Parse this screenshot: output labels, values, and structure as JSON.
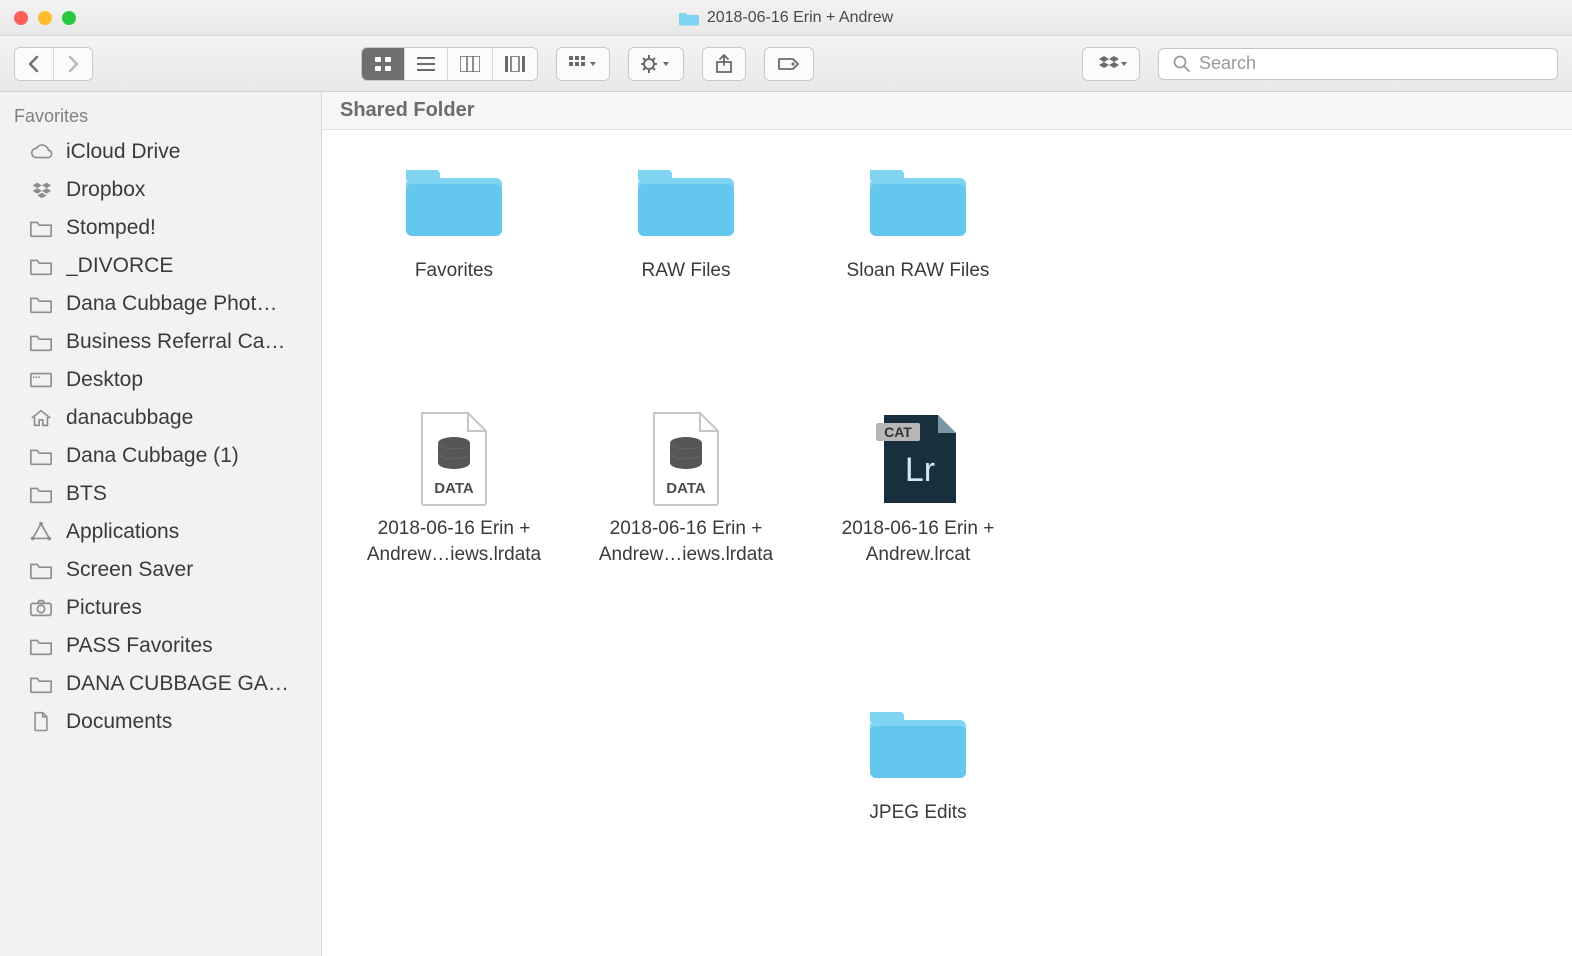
{
  "window": {
    "title": "2018-06-16 Erin + Andrew"
  },
  "toolbar": {
    "search_placeholder": "Search"
  },
  "sidebar": {
    "heading": "Favorites",
    "items": [
      {
        "label": "iCloud Drive",
        "icon": "cloud"
      },
      {
        "label": "Dropbox",
        "icon": "dropbox"
      },
      {
        "label": "Stomped!",
        "icon": "folder"
      },
      {
        "label": "_DIVORCE",
        "icon": "folder"
      },
      {
        "label": "Dana Cubbage Phot…",
        "icon": "folder"
      },
      {
        "label": "Business Referral Ca…",
        "icon": "folder"
      },
      {
        "label": "Desktop",
        "icon": "desktop"
      },
      {
        "label": "danacubbage",
        "icon": "home"
      },
      {
        "label": "Dana Cubbage (1)",
        "icon": "folder"
      },
      {
        "label": "BTS",
        "icon": "folder"
      },
      {
        "label": "Applications",
        "icon": "apps"
      },
      {
        "label": "Screen Saver",
        "icon": "folder"
      },
      {
        "label": "Pictures",
        "icon": "camera"
      },
      {
        "label": "PASS Favorites",
        "icon": "folder"
      },
      {
        "label": "DANA CUBBAGE GA…",
        "icon": "folder"
      },
      {
        "label": "Documents",
        "icon": "document"
      }
    ]
  },
  "info_bar": "Shared Folder",
  "items": [
    {
      "type": "folder",
      "line1": "Favorites",
      "line2": ""
    },
    {
      "type": "folder",
      "line1": "RAW Files",
      "line2": ""
    },
    {
      "type": "folder",
      "line1": "Sloan RAW Files",
      "line2": ""
    },
    {
      "type": "spacer"
    },
    {
      "type": "data",
      "line1": "2018-06-16 Erin +",
      "line2": "Andrew…iews.lrdata"
    },
    {
      "type": "data",
      "line1": "2018-06-16 Erin +",
      "line2": "Andrew…iews.lrdata"
    },
    {
      "type": "lrcat",
      "line1": "2018-06-16 Erin +",
      "line2": "Andrew.lrcat"
    },
    {
      "type": "spacer"
    },
    {
      "type": "spacer"
    },
    {
      "type": "spacer"
    },
    {
      "type": "folder",
      "line1": "JPEG Edits",
      "line2": ""
    }
  ],
  "file_labels": {
    "data": "DATA",
    "cat": "CAT",
    "lr": "Lr"
  }
}
